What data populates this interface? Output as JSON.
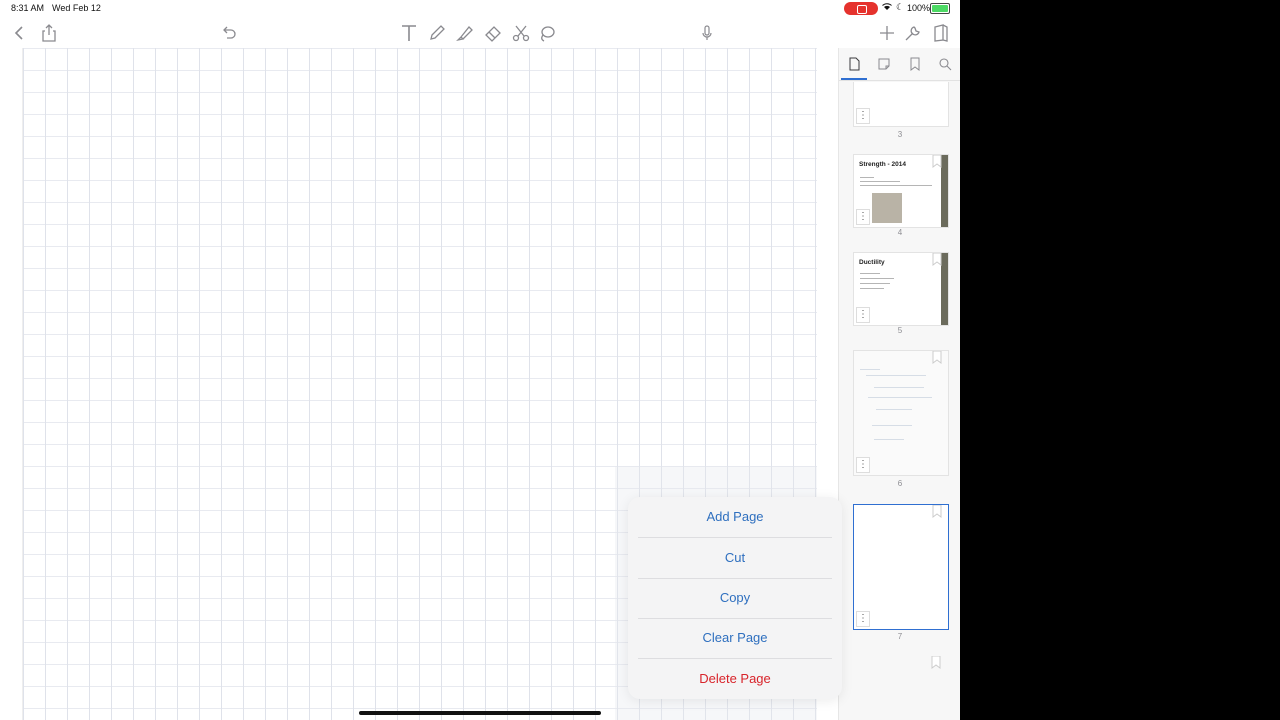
{
  "status_bar": {
    "time": "8:31 AM",
    "date": "Wed Feb 12",
    "battery_text": "100%",
    "battery_level": 1.0,
    "record_color": "#e5322d"
  },
  "toolbar": {
    "icons": [
      "back-chevron-icon",
      "share-icon",
      "undo-icon",
      "text-tool-icon",
      "pen-icon",
      "highlighter-icon",
      "eraser-icon",
      "scissors-icon",
      "lasso-icon",
      "microphone-icon",
      "add-icon",
      "wrench-icon",
      "notebook-icon"
    ]
  },
  "sidebar": {
    "tabs": [
      "pages-tab-icon",
      "outline-tab-icon",
      "bookmark-tab-icon",
      "search-tab-icon"
    ],
    "thumbnails": [
      {
        "page": "3"
      },
      {
        "page": "4",
        "title": "Strength - 2014"
      },
      {
        "page": "5",
        "title": "Ductility"
      },
      {
        "page": "6"
      },
      {
        "page": "7",
        "selected": true
      }
    ]
  },
  "context_menu": {
    "items": [
      {
        "label": "Add Page"
      },
      {
        "label": "Cut"
      },
      {
        "label": "Copy"
      },
      {
        "label": "Clear Page"
      },
      {
        "label": "Delete Page",
        "destructive": true
      }
    ]
  },
  "colors": {
    "accent": "#2f6fd1",
    "menu_text": "#2e6fbf",
    "destructive": "#d8242b"
  }
}
